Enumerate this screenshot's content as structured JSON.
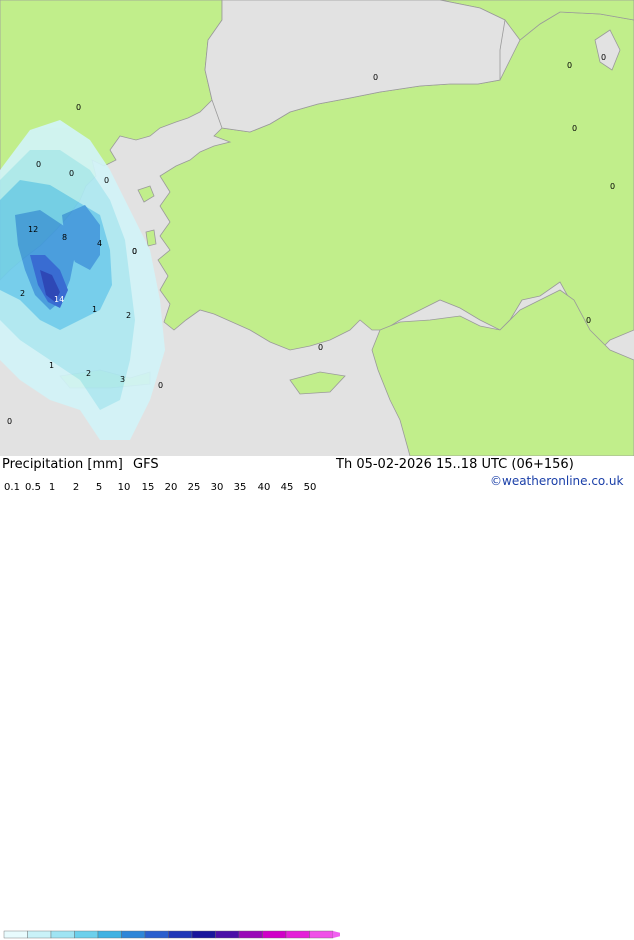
{
  "map": {
    "colors": {
      "sea": "#e2e2e2",
      "land": "#c1ee8b",
      "coast": "#9a9a9a",
      "precip_light": "#d2f4f8",
      "precip_1": "#aee9f2",
      "precip_2": "#6fcdec",
      "precip_5": "#3f99dd",
      "precip_10": "#2b63d1",
      "precip_15": "#1f3cb3"
    },
    "point_values": [
      {
        "label": "0"
      },
      {
        "label": "0"
      },
      {
        "label": "0"
      },
      {
        "label": "0"
      },
      {
        "label": "0"
      },
      {
        "label": "0"
      },
      {
        "label": "0"
      },
      {
        "label": "0"
      },
      {
        "label": "0"
      },
      {
        "label": "0"
      },
      {
        "label": "0"
      },
      {
        "label": "12"
      },
      {
        "label": "8"
      },
      {
        "label": "4"
      },
      {
        "label": "0"
      },
      {
        "label": "2"
      },
      {
        "label": "14"
      },
      {
        "label": "1"
      },
      {
        "label": "2"
      },
      {
        "label": "1"
      },
      {
        "label": "2"
      },
      {
        "label": "3"
      },
      {
        "label": "0"
      },
      {
        "label": "0"
      },
      {
        "label": "0"
      }
    ]
  },
  "footer": {
    "title": "Precipitation [mm]",
    "model": "GFS",
    "datetime": "Th 05-02-2026 15..18 UTC (06+156)",
    "copyright": "©weatheronline.co.uk"
  },
  "legend": {
    "ticks": [
      "0.1",
      "0.5",
      "1",
      "2",
      "5",
      "10",
      "15",
      "20",
      "25",
      "30",
      "35",
      "40",
      "45",
      "50"
    ],
    "colors": [
      "#e8fbfd",
      "#c9f2f8",
      "#9fe4f3",
      "#6cd0ec",
      "#3fb2e3",
      "#2e86d8",
      "#2a5fce",
      "#2038b8",
      "#18169c",
      "#4b10a8",
      "#9a0ab8",
      "#d000c8",
      "#e420d8",
      "#f050e8"
    ],
    "arrow_color": "#f060f0"
  }
}
